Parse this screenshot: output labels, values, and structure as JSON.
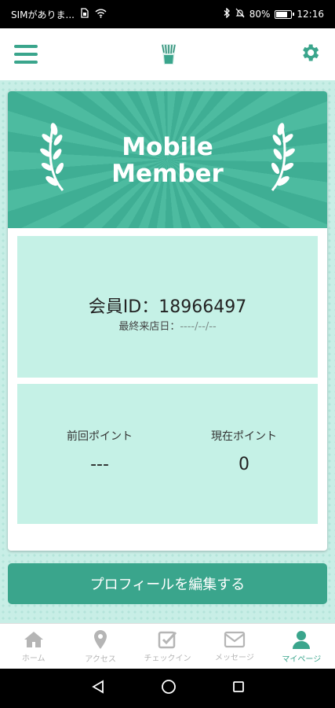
{
  "status_bar": {
    "carrier": "SIMがありま...",
    "battery": "80%",
    "battery_level": 0.8,
    "time": "12:16"
  },
  "header": {
    "menu_icon": "hamburger-icon",
    "settings_icon": "gear-icon",
    "accent_color": "#3aa58c"
  },
  "banner": {
    "title_line1": "Mobile",
    "title_line2": "Member"
  },
  "member": {
    "id_label": "会員ID：",
    "id_value": "18966497",
    "last_visit_label": "最終来店日：",
    "last_visit_value": "----/--/--"
  },
  "points": {
    "previous_label": "前回ポイント",
    "previous_value": "---",
    "current_label": "現在ポイント",
    "current_value": "0"
  },
  "edit_button": {
    "label": "プロフィールを編集する"
  },
  "tabs": [
    {
      "label": "ホーム",
      "icon": "home-icon"
    },
    {
      "label": "アクセス",
      "icon": "location-pin-icon"
    },
    {
      "label": "チェックイン",
      "icon": "checkbox-icon"
    },
    {
      "label": "メッセージ",
      "icon": "mail-icon"
    },
    {
      "label": "マイページ",
      "icon": "user-icon",
      "active": true
    }
  ]
}
